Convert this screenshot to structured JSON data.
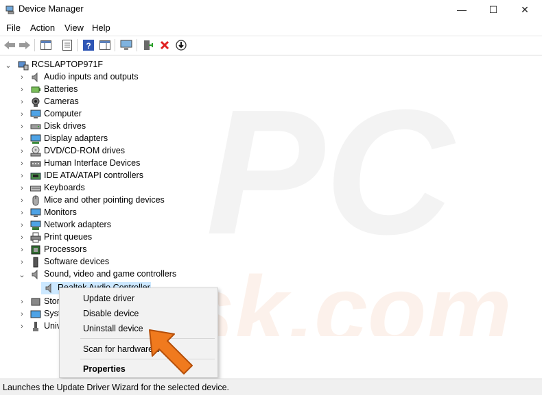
{
  "window": {
    "title": "Device Manager",
    "minimize_glyph": "—",
    "maximize_glyph": "☐",
    "close_glyph": "✕"
  },
  "menu": [
    "File",
    "Action",
    "View",
    "Help"
  ],
  "toolbar": {
    "buttons": [
      "back-icon",
      "forward-icon",
      "show-hide-console-tree-icon",
      "properties-icon",
      "help-icon",
      "action-pane-icon",
      "scan-hardware-icon",
      "update-driver-icon",
      "uninstall-icon",
      "disable-icon"
    ]
  },
  "tree": {
    "root": "RCSLAPTOP971F",
    "categories": [
      "Audio inputs and outputs",
      "Batteries",
      "Cameras",
      "Computer",
      "Disk drives",
      "Display adapters",
      "DVD/CD-ROM drives",
      "Human Interface Devices",
      "IDE ATA/ATAPI controllers",
      "Keyboards",
      "Mice and other pointing devices",
      "Monitors",
      "Network adapters",
      "Print queues",
      "Processors",
      "Software devices",
      "Sound, video and game controllers"
    ],
    "selected_child": "Realtek Audio Controller",
    "after": [
      "Stor",
      "Syst",
      "Univ"
    ]
  },
  "context_menu": {
    "update": "Update driver",
    "disable": "Disable device",
    "uninstall": "Uninstall device",
    "scan": "Scan for hardware c",
    "properties": "Properties"
  },
  "status": "Launches the Update Driver Wizard for the selected device.",
  "colors": {
    "selection": "#cce8ff",
    "arrow": "#f07a1e",
    "close_red": "#e02020"
  }
}
